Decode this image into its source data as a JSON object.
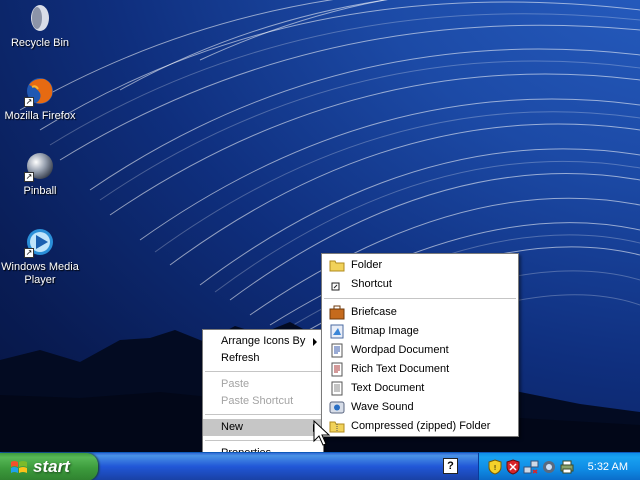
{
  "desktop": {
    "icons": [
      {
        "label": "Recycle Bin",
        "icon": "recycle-bin-icon"
      },
      {
        "label": "Mozilla Firefox",
        "icon": "firefox-icon"
      },
      {
        "label": "Pinball",
        "icon": "pinball-icon"
      },
      {
        "label": "Windows Media Player",
        "icon": "media-player-icon"
      }
    ]
  },
  "context_menu": {
    "items": [
      {
        "label": "Arrange Icons By",
        "state": "enabled",
        "has_submenu": true
      },
      {
        "label": "Refresh",
        "state": "enabled"
      },
      {
        "label": "Paste",
        "state": "disabled"
      },
      {
        "label": "Paste Shortcut",
        "state": "disabled"
      },
      {
        "label": "New",
        "state": "highlighted",
        "has_submenu": true
      },
      {
        "label": "Properties",
        "state": "enabled"
      }
    ]
  },
  "new_submenu": {
    "items": [
      {
        "label": "Folder",
        "icon": "folder-icon"
      },
      {
        "label": "Shortcut",
        "icon": "shortcut-icon"
      },
      {
        "label": "Briefcase",
        "icon": "briefcase-icon"
      },
      {
        "label": "Bitmap Image",
        "icon": "bitmap-icon"
      },
      {
        "label": "Wordpad Document",
        "icon": "wordpad-icon"
      },
      {
        "label": "Rich Text Document",
        "icon": "rich-text-icon"
      },
      {
        "label": "Text Document",
        "icon": "text-document-icon"
      },
      {
        "label": "Wave Sound",
        "icon": "wave-sound-icon"
      },
      {
        "label": "Compressed (zipped) Folder",
        "icon": "zip-folder-icon"
      }
    ]
  },
  "taskbar": {
    "start_label": "start",
    "help_glyph": "?",
    "clock": "5:32 AM",
    "tray_icons": [
      "security-shield-icon",
      "antivirus-icon",
      "network-icon",
      "update-icon",
      "printer-icon"
    ]
  },
  "colors": {
    "desktop_sky": "#0f2f7e",
    "taskbar_blue": "#2157d7",
    "start_green": "#3c9b3c",
    "tray_blue": "#0f8de7",
    "menu_highlight": "#c6c6c6",
    "menu_disabled_text": "#a3a3a3"
  }
}
